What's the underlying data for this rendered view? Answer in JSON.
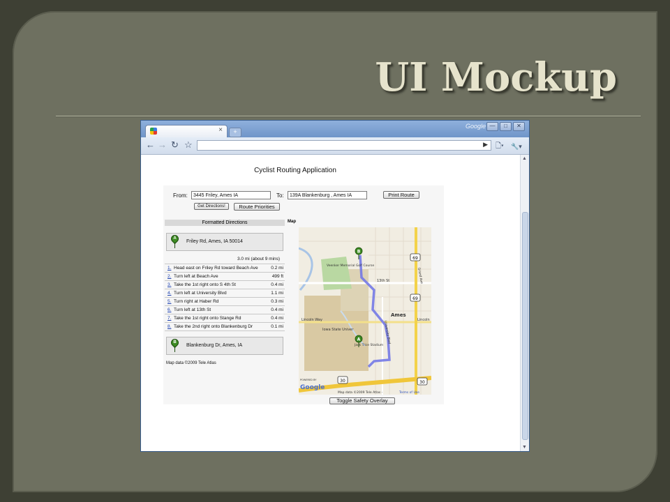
{
  "slide": {
    "title": "UI Mockup"
  },
  "browser": {
    "brand": "Google",
    "tab": {
      "close": "×"
    },
    "new_tab": "+",
    "window_buttons": [
      "—",
      "□",
      "✕"
    ],
    "toolbar": {
      "back": "←",
      "forward": "→",
      "reload": "↻",
      "star": "☆",
      "go": "▶",
      "page": "🗋▾",
      "wrench": "🔧▾"
    }
  },
  "app": {
    "title": "Cyclist Routing Application",
    "from_label": "From:",
    "from_value": "3445 Friley, Ames IA",
    "to_label": "To:",
    "to_value": "139A Blankenburg , Ames IA",
    "print_button": "Print Route",
    "get_directions_button": "Get Directions!",
    "route_priorities_button": "Route Priorities",
    "directions_header": "Formatted Directions",
    "map_header": "Map",
    "start": {
      "marker": "A",
      "address": "Friley Rd, Ames, IA 50014"
    },
    "end": {
      "marker": "B",
      "address": "Blankenburg Dr, Ames, IA"
    },
    "summary": "3.0 mi (about 9 mins)",
    "steps": [
      {
        "num": "1.",
        "text": "Head east on Friley Rd toward Beach Ave",
        "dist": "0.2 mi"
      },
      {
        "num": "2.",
        "text": "Turn left at Beach Ave",
        "dist": "499 ft"
      },
      {
        "num": "3.",
        "text": "Take the 1st right onto S 4th St",
        "dist": "0.4 mi"
      },
      {
        "num": "4.",
        "text": "Turn left at University Blvd",
        "dist": "1.1 mi"
      },
      {
        "num": "5.",
        "text": "Turn right at Haber Rd",
        "dist": "0.3 mi"
      },
      {
        "num": "6.",
        "text": "Turn left at 13th St",
        "dist": "0.4 mi"
      },
      {
        "num": "7.",
        "text": "Take the 1st right onto Stange Rd",
        "dist": "0.4 mi"
      },
      {
        "num": "8.",
        "text": "Take the 2nd right onto Blankenburg Dr",
        "dist": "0.1 mi"
      }
    ],
    "map_data_note": "Map data ©2009 Tele Atlas",
    "toggle_button": "Toggle Safety Overlay",
    "map": {
      "labels": {
        "golf": "Veenker Memorial Golf Course",
        "thirteenth": "13th St",
        "lincoln_way": "Lincoln Way",
        "lincoln": "Lincoln",
        "ames": "Ames",
        "isu": "Iowa State Univer",
        "stadium": "Jack Trice Stadium",
        "grand": "Grand Ave",
        "university": "University Blvd",
        "powered_by": "POWERED BY",
        "google": "Google",
        "credit": "Map data ©2009 Tele Atlas -",
        "terms": "Terms of Use",
        "hwy_69a": "69",
        "hwy_69b": "69",
        "hwy_30a": "30",
        "hwy_30b": "30",
        "marker_a": "A",
        "marker_b": "B"
      }
    }
  }
}
